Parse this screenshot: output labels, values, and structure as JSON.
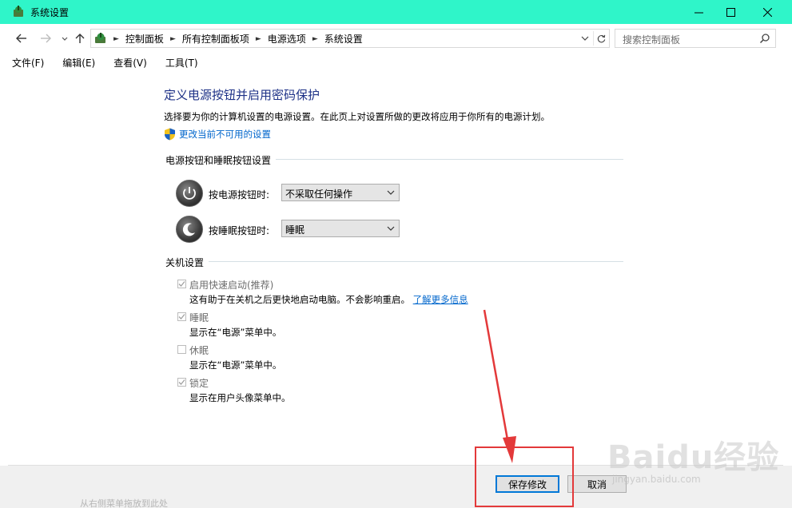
{
  "window": {
    "title": "系统设置",
    "icons": {
      "app": "power-options-icon",
      "minimize": "minimize-icon",
      "maximize": "maximize-icon",
      "close": "close-icon"
    },
    "accent": "#2ff5c9"
  },
  "nav": {
    "breadcrumbs": [
      "控制面板",
      "所有控制面板项",
      "电源选项",
      "系统设置"
    ],
    "search_placeholder": "搜索控制面板"
  },
  "menu": [
    "文件(F)",
    "编辑(E)",
    "查看(V)",
    "工具(T)"
  ],
  "main": {
    "heading": "定义电源按钮并启用密码保护",
    "description": "选择要为你的计算机设置的电源设置。在此页上对设置所做的更改将应用于你所有的电源计划。",
    "change_link": "更改当前不可用的设置",
    "power_group_title": "电源按钮和睡眠按钮设置",
    "power_button_label": "按电源按钮时:",
    "power_button_value": "不采取任何操作",
    "sleep_button_label": "按睡眠按钮时:",
    "sleep_button_value": "睡眠",
    "shutdown_group_title": "关机设置",
    "options": [
      {
        "label": "启用快速启动(推荐)",
        "desc": "这有助于在关机之后更快地启动电脑。不会影响重启。",
        "link": "了解更多信息",
        "checked": true
      },
      {
        "label": "睡眠",
        "desc": "显示在“电源”菜单中。",
        "checked": true
      },
      {
        "label": "休眠",
        "desc": "显示在“电源”菜单中。",
        "checked": false
      },
      {
        "label": "锁定",
        "desc": "显示在用户头像菜单中。",
        "checked": true
      }
    ]
  },
  "footer": {
    "save_label": "保存修改",
    "cancel_label": "取消"
  },
  "overlay": {
    "watermark": "Baidu经验",
    "watermark_sub": "jingyan.baidu.com",
    "bottom_text": "从右侧菜单拖放到此处",
    "highlight_color": "#e3393a"
  }
}
